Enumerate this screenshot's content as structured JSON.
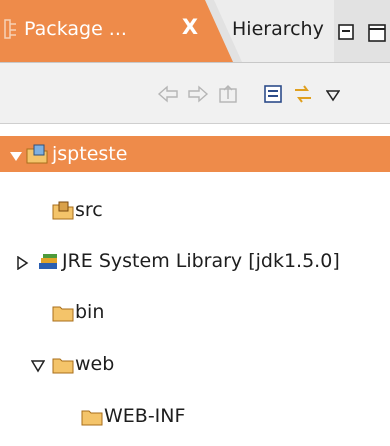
{
  "tabs": {
    "active": {
      "label": "Package ...",
      "close": "X"
    },
    "inactive": {
      "label": "Hierarchy"
    }
  },
  "toolbar": {
    "buttons": [
      "back-arrow",
      "forward-arrow",
      "up-one-level",
      "collapse-all",
      "link-with-editor",
      "view-menu"
    ]
  },
  "tree": {
    "items": [
      {
        "label": "jspteste",
        "expanded": true,
        "selected": true
      },
      {
        "label": "src"
      },
      {
        "label": "JRE System Library [jdk1.5.0]",
        "expanded": false
      },
      {
        "label": "bin"
      },
      {
        "label": "web",
        "expanded": true
      },
      {
        "label": "WEB-INF"
      }
    ]
  },
  "colors": {
    "accent": "#ee8b4a",
    "tabbar": "#e2e2e2",
    "toolbar": "#f1f1f1",
    "folder": "#f1b860"
  }
}
